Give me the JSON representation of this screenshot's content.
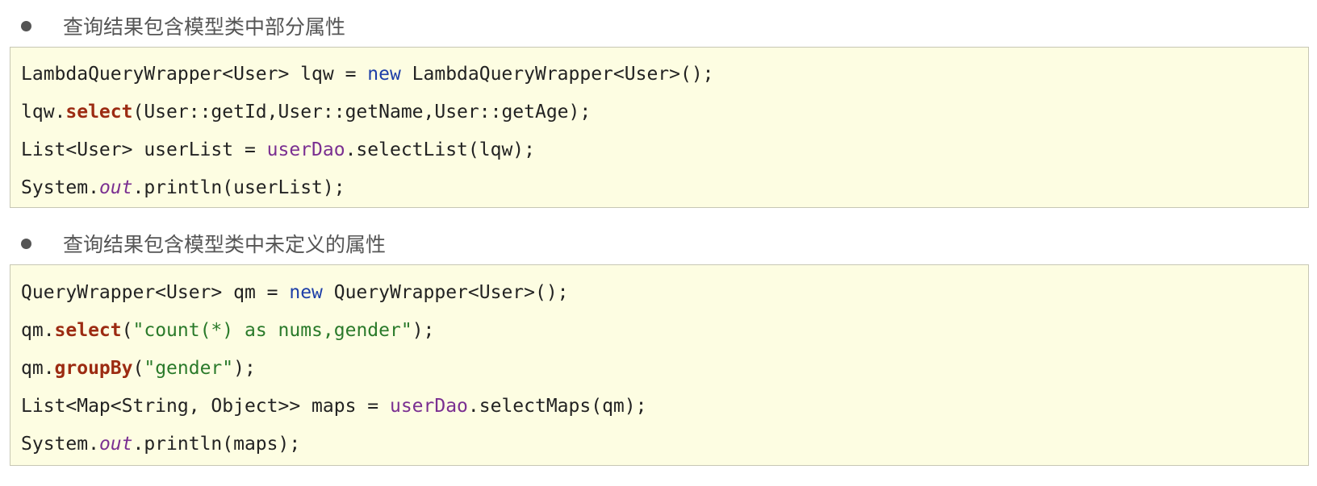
{
  "sections": [
    {
      "heading": "查询结果包含模型类中部分属性",
      "lines": [
        [
          {
            "t": "LambdaQueryWrapper<User> lqw = ",
            "k": "plain"
          },
          {
            "t": "new",
            "k": "keyword"
          },
          {
            "t": " LambdaQueryWrapper<User>();",
            "k": "plain"
          }
        ],
        [
          {
            "t": "lqw.",
            "k": "plain"
          },
          {
            "t": "select",
            "k": "method"
          },
          {
            "t": "(User::getId,User::getName,User::getAge);",
            "k": "plain"
          }
        ],
        [
          {
            "t": "List<User> userList = ",
            "k": "plain"
          },
          {
            "t": "userDao",
            "k": "field"
          },
          {
            "t": ".selectList(lqw);",
            "k": "plain"
          }
        ],
        [
          {
            "t": "System.",
            "k": "plain"
          },
          {
            "t": "out",
            "k": "static"
          },
          {
            "t": ".println(userList);",
            "k": "plain"
          }
        ]
      ]
    },
    {
      "heading": "查询结果包含模型类中未定义的属性",
      "lines": [
        [
          {
            "t": "QueryWrapper<User> qm = ",
            "k": "plain"
          },
          {
            "t": "new",
            "k": "keyword"
          },
          {
            "t": " QueryWrapper<User>();",
            "k": "plain"
          }
        ],
        [
          {
            "t": "qm.",
            "k": "plain"
          },
          {
            "t": "select",
            "k": "method"
          },
          {
            "t": "(",
            "k": "plain"
          },
          {
            "t": "\"count(*) as nums,gender\"",
            "k": "string"
          },
          {
            "t": ");",
            "k": "plain"
          }
        ],
        [
          {
            "t": "qm.",
            "k": "plain"
          },
          {
            "t": "groupBy",
            "k": "method"
          },
          {
            "t": "(",
            "k": "plain"
          },
          {
            "t": "\"gender\"",
            "k": "string"
          },
          {
            "t": ");",
            "k": "plain"
          }
        ],
        [
          {
            "t": "List<Map<String, Object>> maps = ",
            "k": "plain"
          },
          {
            "t": "userDao",
            "k": "field"
          },
          {
            "t": ".selectMaps(qm);",
            "k": "plain"
          }
        ],
        [
          {
            "t": "System.",
            "k": "plain"
          },
          {
            "t": "out",
            "k": "static"
          },
          {
            "t": ".println(maps);",
            "k": "plain"
          }
        ]
      ]
    }
  ]
}
